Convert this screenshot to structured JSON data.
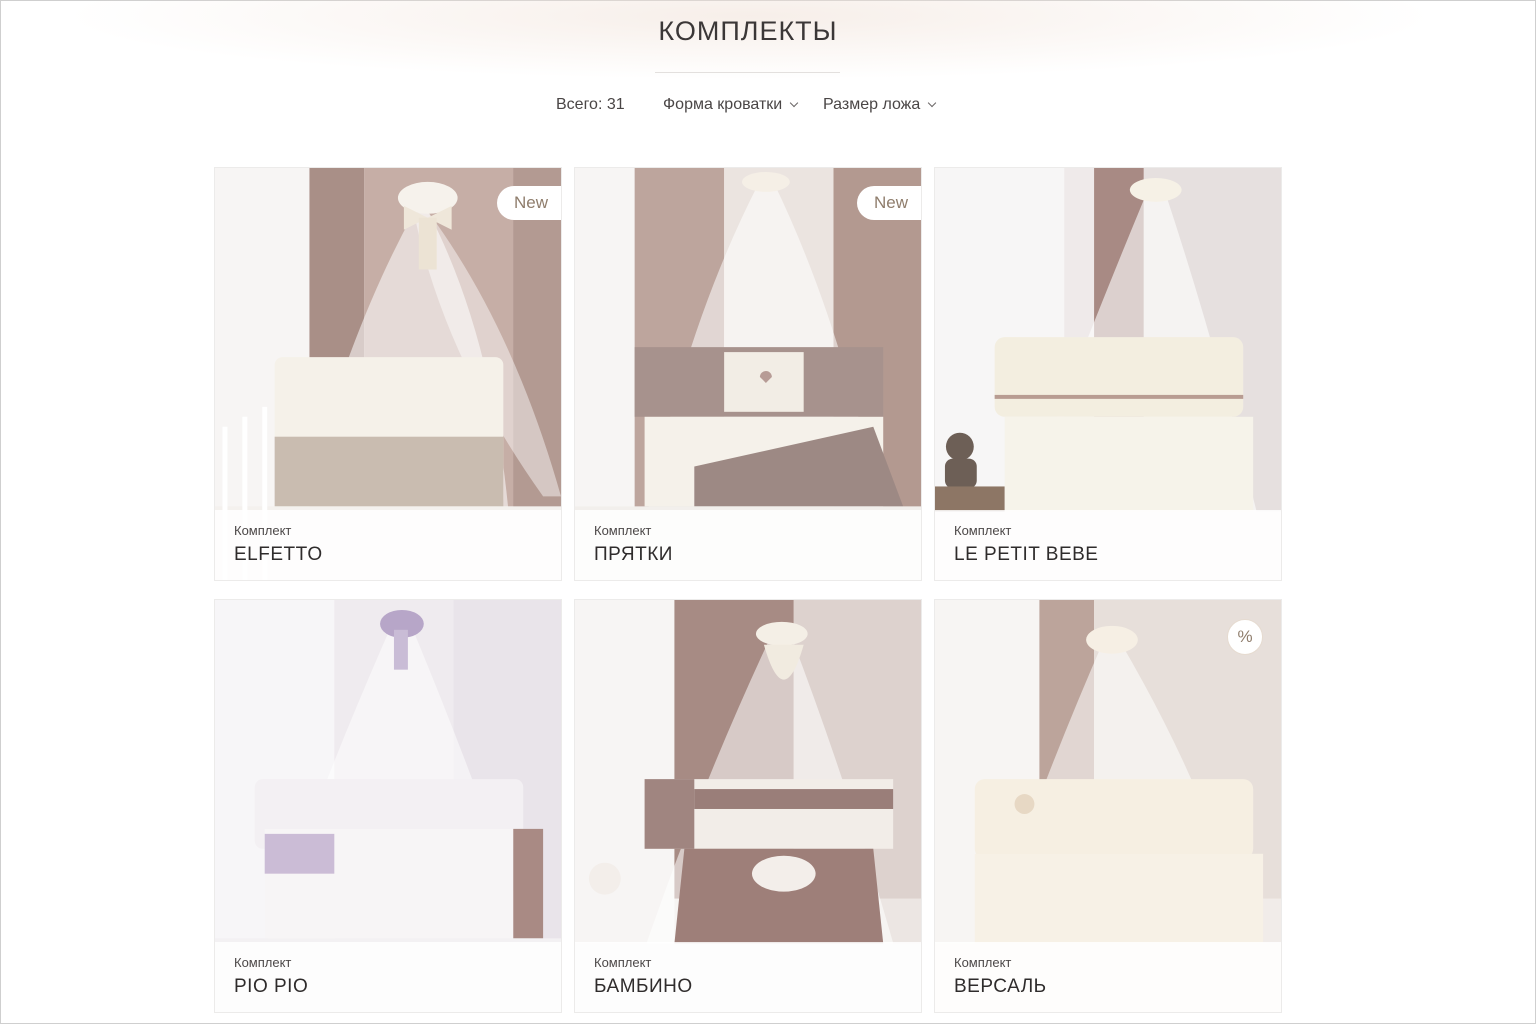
{
  "page": {
    "title": "КОМПЛЕКТЫ",
    "total_label": "Всего: 31"
  },
  "filters": [
    {
      "label": "Форма кроватки"
    },
    {
      "label": "Размер ложа"
    }
  ],
  "products": [
    {
      "type": "Комплект",
      "name": "ELFETTO",
      "badge": "New"
    },
    {
      "type": "Комплект",
      "name": "ПРЯТКИ",
      "badge": "New"
    },
    {
      "type": "Комплект",
      "name": "LE PETIT BEBE",
      "badge": ""
    },
    {
      "type": "Комплект",
      "name": "PIO PIO",
      "badge": ""
    },
    {
      "type": "Комплект",
      "name": "БАМБИНО",
      "badge": ""
    },
    {
      "type": "Комплект",
      "name": "ВЕРСАЛЬ",
      "badge": "%"
    }
  ],
  "colors": {
    "accent_badge_text": "#8f7d6c",
    "curtain_mauve": "#a88f88",
    "bedding_brown": "#9c7f7a",
    "lavender": "#b7a6c8"
  }
}
